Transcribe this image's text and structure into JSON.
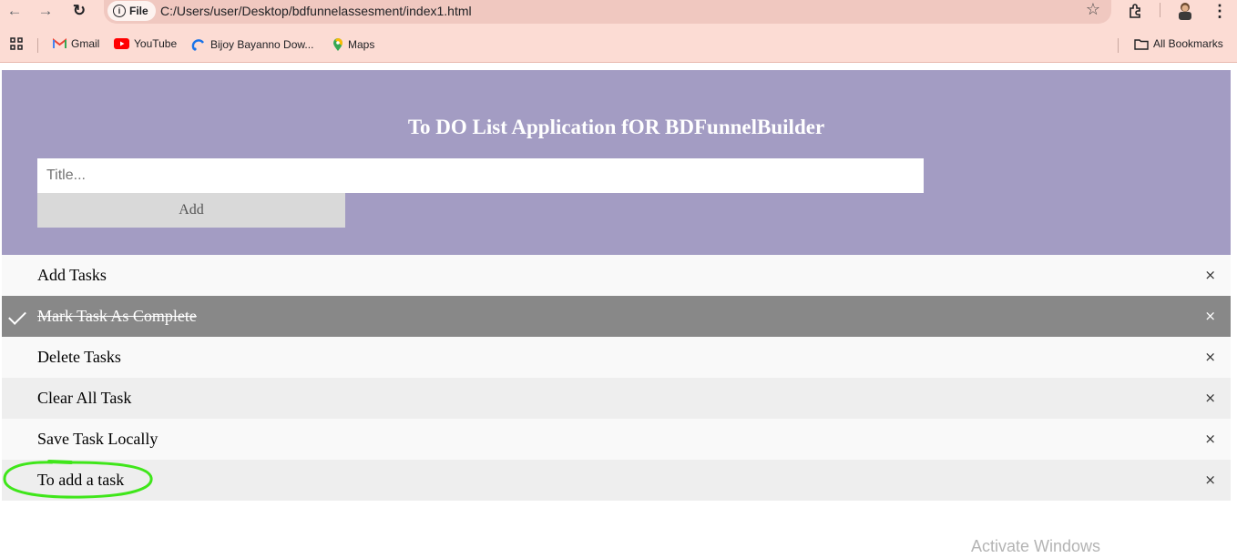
{
  "browser": {
    "site_chip": "File",
    "url": "C:/Users/user/Desktop/bdfunnelassesment/index1.html",
    "bookmarks": [
      {
        "label": "Gmail",
        "icon": "gmail-icon"
      },
      {
        "label": "YouTube",
        "icon": "youtube-icon"
      },
      {
        "label": "Bijoy Bayanno Dow...",
        "icon": "bijoy-icon"
      },
      {
        "label": "Maps",
        "icon": "maps-icon"
      }
    ],
    "all_bookmarks": "All Bookmarks"
  },
  "app": {
    "title": "To DO List Application fOR BDFunnelBuilder",
    "input": {
      "placeholder": "Title...",
      "value": ""
    },
    "add_label": "Add",
    "tasks": [
      {
        "label": "Add Tasks",
        "completed": false
      },
      {
        "label": "Mark Task As Complete",
        "completed": true
      },
      {
        "label": "Delete Tasks",
        "completed": false
      },
      {
        "label": "Clear All Task",
        "completed": false
      },
      {
        "label": "Save Task Locally",
        "completed": false
      },
      {
        "label": "To add a task",
        "completed": false
      }
    ],
    "close_symbol": "×"
  },
  "annotation": {
    "color": "#3fe61a"
  },
  "colors": {
    "header": "#a39cc3",
    "completed": "#888888"
  },
  "watermark": "Activate Windows"
}
